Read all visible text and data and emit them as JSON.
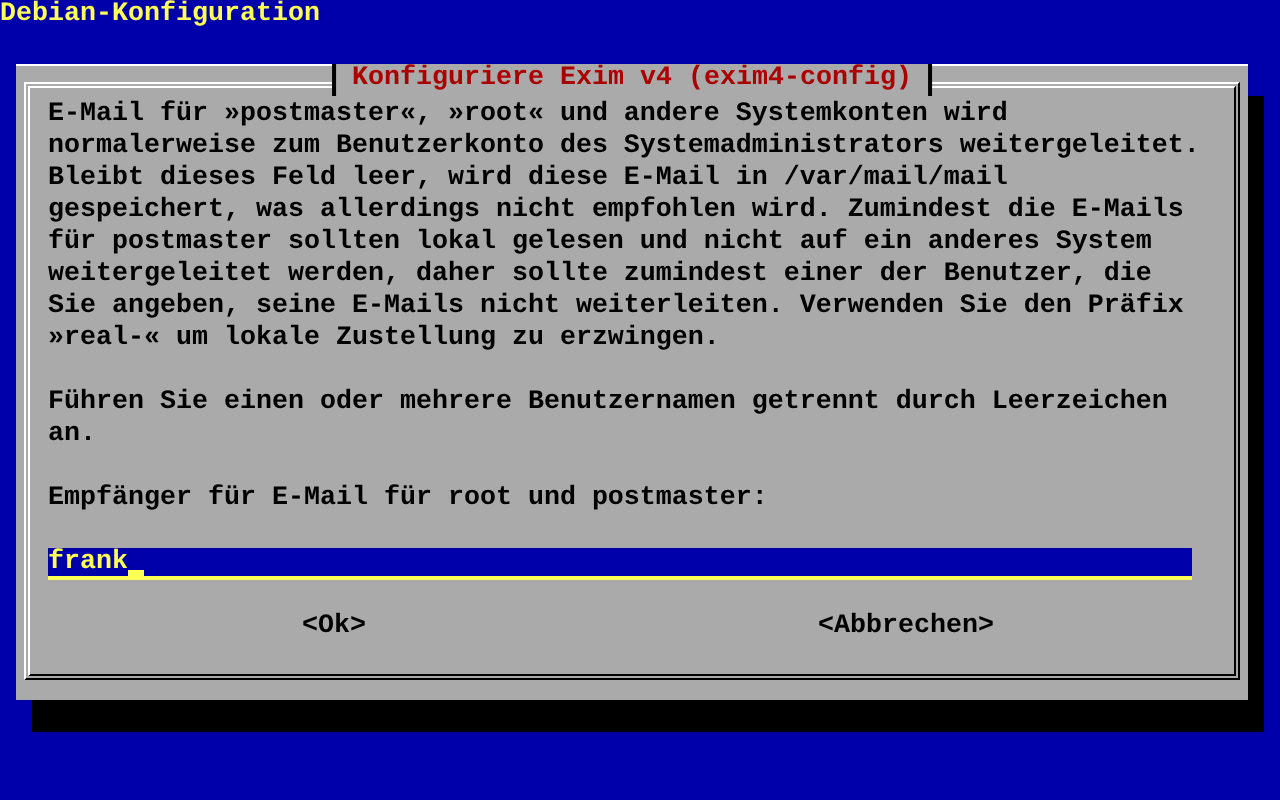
{
  "screen": {
    "title": "Debian-Konfiguration"
  },
  "dialog": {
    "title": "Konfiguriere Exim v4 (exim4-config)",
    "paragraphs": [
      "E-Mail für »postmaster«, »root« und andere Systemkonten wird normalerweise zum Benutzerkonto des Systemadministrators weitergeleitet. Bleibt dieses Feld leer, wird diese E-Mail in /var/mail/mail gespeichert, was allerdings nicht empfohlen wird. Zumindest die E-Mails für postmaster sollten lokal gelesen und nicht auf ein anderes System weitergeleitet werden, daher sollte zumindest einer der Benutzer, die Sie angeben, seine E-Mails nicht weiterleiten. Verwenden Sie den Präfix »real-« um lokale Zustellung zu erzwingen.",
      "Führen Sie einen oder mehrere Benutzernamen getrennt durch Leerzeichen an."
    ],
    "prompt": "Empfänger für E-Mail für root und postmaster:",
    "input": {
      "value": "frank",
      "focused": true
    },
    "buttons": [
      {
        "label": "<Ok>",
        "selected": false
      },
      {
        "label": "<Abbrechen>",
        "selected": false
      }
    ]
  }
}
